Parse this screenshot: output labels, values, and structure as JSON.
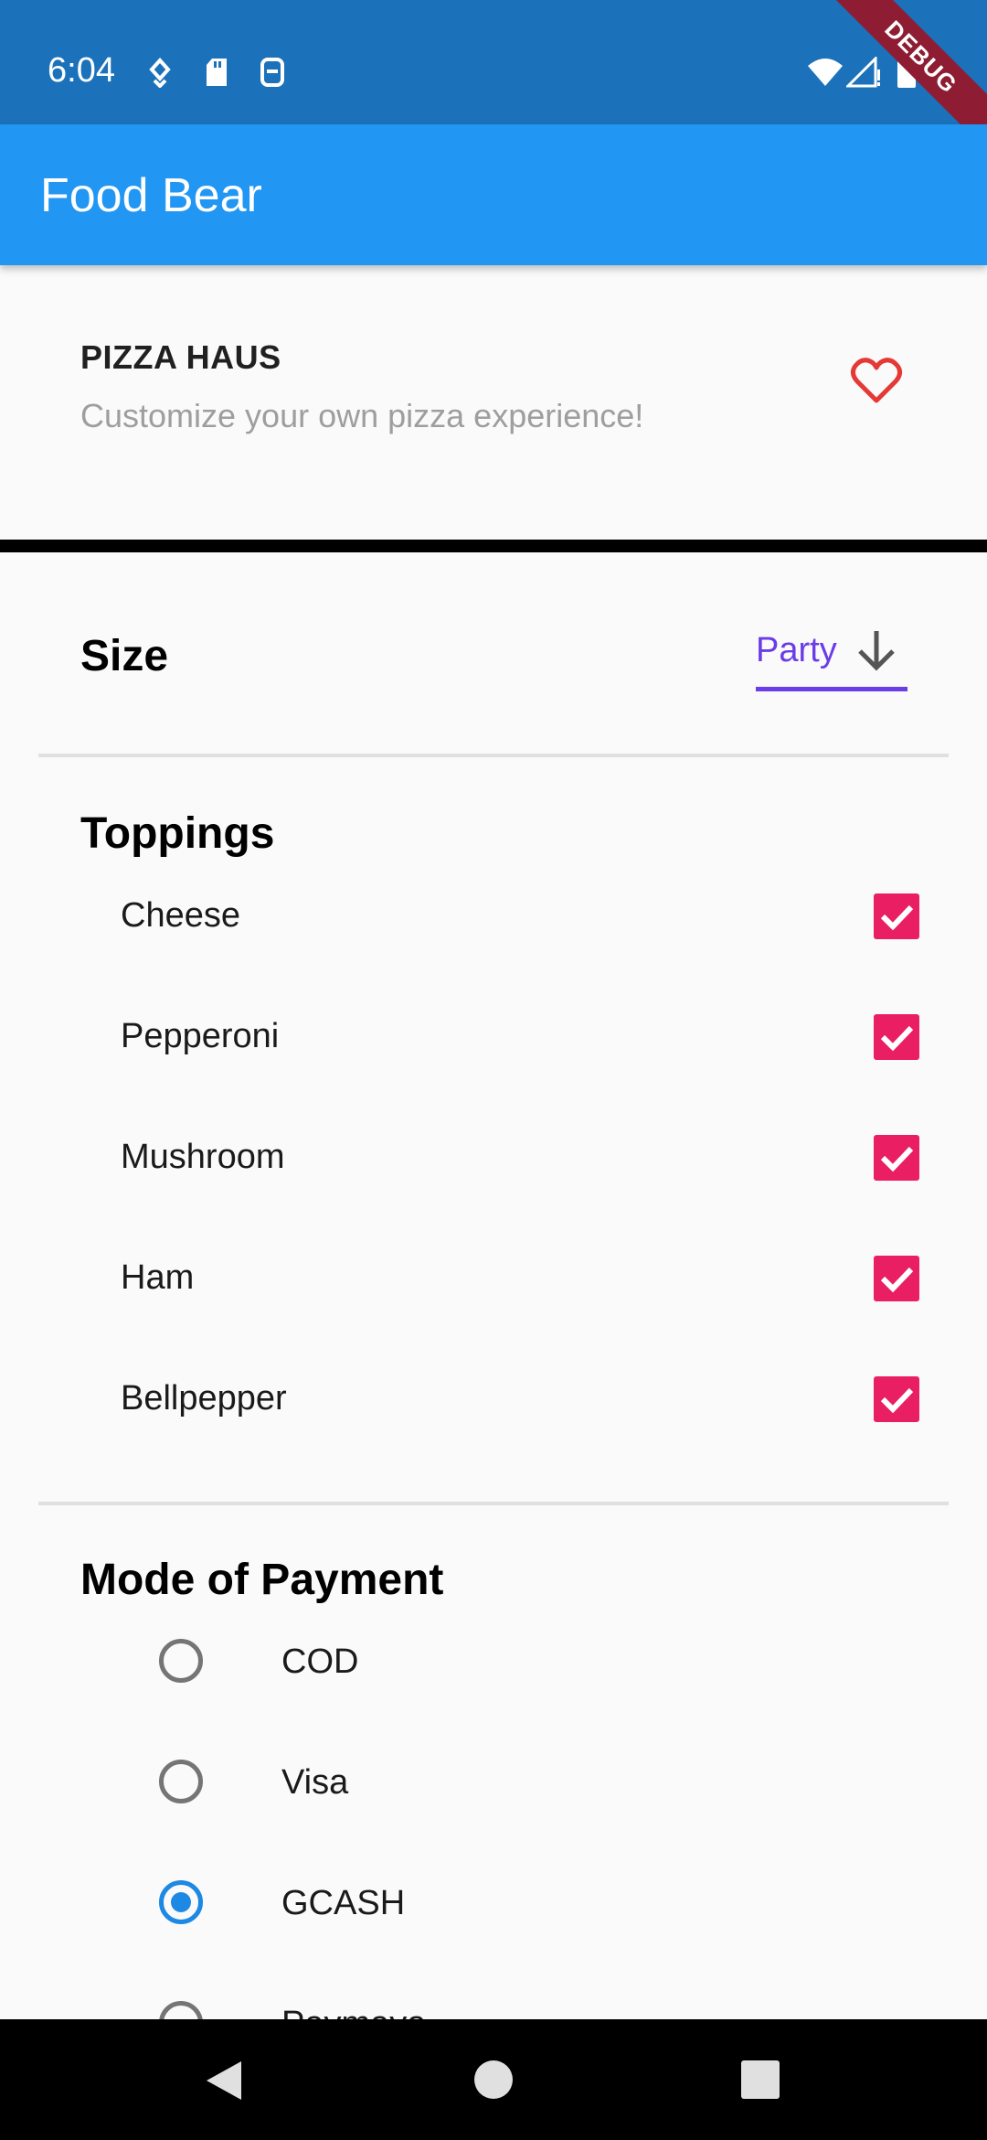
{
  "status_bar": {
    "time": "6:04",
    "left_icons": [
      "location-icon",
      "sd-card-icon",
      "sim-icon"
    ],
    "right_icons": [
      "wifi-icon",
      "signal-icon",
      "battery-icon"
    ],
    "debug_banner": "DEBUG"
  },
  "app_bar": {
    "title": "Food Bear"
  },
  "store": {
    "name": "PIZZA HAUS",
    "description": "Customize your own pizza experience!",
    "favorite_icon": "heart-outline-icon"
  },
  "size": {
    "label": "Size",
    "selected": "Party"
  },
  "toppings": {
    "title": "Toppings",
    "items": [
      {
        "label": "Cheese",
        "checked": true
      },
      {
        "label": "Pepperoni",
        "checked": true
      },
      {
        "label": "Mushroom",
        "checked": true
      },
      {
        "label": "Ham",
        "checked": true
      },
      {
        "label": "Bellpepper",
        "checked": true
      }
    ]
  },
  "payment": {
    "title": "Mode of Payment",
    "options": [
      {
        "label": "COD",
        "selected": false
      },
      {
        "label": "Visa",
        "selected": false
      },
      {
        "label": "GCASH",
        "selected": true
      },
      {
        "label": "Paymaya",
        "selected": false
      }
    ]
  },
  "colors": {
    "status_bar": "#1b72bb",
    "app_bar": "#2196f3",
    "checkbox": "#e91e63",
    "radio_selected": "#1e88e5",
    "dropdown_accent": "#6a3de8",
    "heart": "#e53935"
  }
}
